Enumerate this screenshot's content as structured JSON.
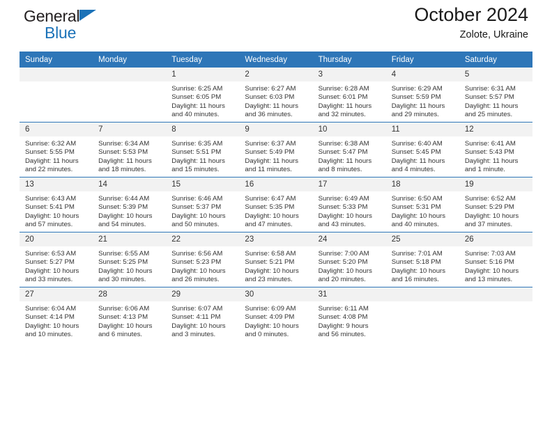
{
  "brand": {
    "line1": "General",
    "line2": "Blue",
    "accent_color": "#1b72b8",
    "triangle_icon": "triangle-icon"
  },
  "header": {
    "title": "October 2024",
    "subtitle": "Zolote, Ukraine"
  },
  "calendar": {
    "header_bg": "#2e76b8",
    "daynum_bg": "#f2f2f2",
    "weekdays": [
      "Sunday",
      "Monday",
      "Tuesday",
      "Wednesday",
      "Thursday",
      "Friday",
      "Saturday"
    ],
    "weeks": [
      [
        {
          "day": "",
          "lines": []
        },
        {
          "day": "",
          "lines": []
        },
        {
          "day": "1",
          "lines": [
            "Sunrise: 6:25 AM",
            "Sunset: 6:05 PM",
            "Daylight: 11 hours",
            "and 40 minutes."
          ]
        },
        {
          "day": "2",
          "lines": [
            "Sunrise: 6:27 AM",
            "Sunset: 6:03 PM",
            "Daylight: 11 hours",
            "and 36 minutes."
          ]
        },
        {
          "day": "3",
          "lines": [
            "Sunrise: 6:28 AM",
            "Sunset: 6:01 PM",
            "Daylight: 11 hours",
            "and 32 minutes."
          ]
        },
        {
          "day": "4",
          "lines": [
            "Sunrise: 6:29 AM",
            "Sunset: 5:59 PM",
            "Daylight: 11 hours",
            "and 29 minutes."
          ]
        },
        {
          "day": "5",
          "lines": [
            "Sunrise: 6:31 AM",
            "Sunset: 5:57 PM",
            "Daylight: 11 hours",
            "and 25 minutes."
          ]
        }
      ],
      [
        {
          "day": "6",
          "lines": [
            "Sunrise: 6:32 AM",
            "Sunset: 5:55 PM",
            "Daylight: 11 hours",
            "and 22 minutes."
          ]
        },
        {
          "day": "7",
          "lines": [
            "Sunrise: 6:34 AM",
            "Sunset: 5:53 PM",
            "Daylight: 11 hours",
            "and 18 minutes."
          ]
        },
        {
          "day": "8",
          "lines": [
            "Sunrise: 6:35 AM",
            "Sunset: 5:51 PM",
            "Daylight: 11 hours",
            "and 15 minutes."
          ]
        },
        {
          "day": "9",
          "lines": [
            "Sunrise: 6:37 AM",
            "Sunset: 5:49 PM",
            "Daylight: 11 hours",
            "and 11 minutes."
          ]
        },
        {
          "day": "10",
          "lines": [
            "Sunrise: 6:38 AM",
            "Sunset: 5:47 PM",
            "Daylight: 11 hours",
            "and 8 minutes."
          ]
        },
        {
          "day": "11",
          "lines": [
            "Sunrise: 6:40 AM",
            "Sunset: 5:45 PM",
            "Daylight: 11 hours",
            "and 4 minutes."
          ]
        },
        {
          "day": "12",
          "lines": [
            "Sunrise: 6:41 AM",
            "Sunset: 5:43 PM",
            "Daylight: 11 hours",
            "and 1 minute."
          ]
        }
      ],
      [
        {
          "day": "13",
          "lines": [
            "Sunrise: 6:43 AM",
            "Sunset: 5:41 PM",
            "Daylight: 10 hours",
            "and 57 minutes."
          ]
        },
        {
          "day": "14",
          "lines": [
            "Sunrise: 6:44 AM",
            "Sunset: 5:39 PM",
            "Daylight: 10 hours",
            "and 54 minutes."
          ]
        },
        {
          "day": "15",
          "lines": [
            "Sunrise: 6:46 AM",
            "Sunset: 5:37 PM",
            "Daylight: 10 hours",
            "and 50 minutes."
          ]
        },
        {
          "day": "16",
          "lines": [
            "Sunrise: 6:47 AM",
            "Sunset: 5:35 PM",
            "Daylight: 10 hours",
            "and 47 minutes."
          ]
        },
        {
          "day": "17",
          "lines": [
            "Sunrise: 6:49 AM",
            "Sunset: 5:33 PM",
            "Daylight: 10 hours",
            "and 43 minutes."
          ]
        },
        {
          "day": "18",
          "lines": [
            "Sunrise: 6:50 AM",
            "Sunset: 5:31 PM",
            "Daylight: 10 hours",
            "and 40 minutes."
          ]
        },
        {
          "day": "19",
          "lines": [
            "Sunrise: 6:52 AM",
            "Sunset: 5:29 PM",
            "Daylight: 10 hours",
            "and 37 minutes."
          ]
        }
      ],
      [
        {
          "day": "20",
          "lines": [
            "Sunrise: 6:53 AM",
            "Sunset: 5:27 PM",
            "Daylight: 10 hours",
            "and 33 minutes."
          ]
        },
        {
          "day": "21",
          "lines": [
            "Sunrise: 6:55 AM",
            "Sunset: 5:25 PM",
            "Daylight: 10 hours",
            "and 30 minutes."
          ]
        },
        {
          "day": "22",
          "lines": [
            "Sunrise: 6:56 AM",
            "Sunset: 5:23 PM",
            "Daylight: 10 hours",
            "and 26 minutes."
          ]
        },
        {
          "day": "23",
          "lines": [
            "Sunrise: 6:58 AM",
            "Sunset: 5:21 PM",
            "Daylight: 10 hours",
            "and 23 minutes."
          ]
        },
        {
          "day": "24",
          "lines": [
            "Sunrise: 7:00 AM",
            "Sunset: 5:20 PM",
            "Daylight: 10 hours",
            "and 20 minutes."
          ]
        },
        {
          "day": "25",
          "lines": [
            "Sunrise: 7:01 AM",
            "Sunset: 5:18 PM",
            "Daylight: 10 hours",
            "and 16 minutes."
          ]
        },
        {
          "day": "26",
          "lines": [
            "Sunrise: 7:03 AM",
            "Sunset: 5:16 PM",
            "Daylight: 10 hours",
            "and 13 minutes."
          ]
        }
      ],
      [
        {
          "day": "27",
          "lines": [
            "Sunrise: 6:04 AM",
            "Sunset: 4:14 PM",
            "Daylight: 10 hours",
            "and 10 minutes."
          ]
        },
        {
          "day": "28",
          "lines": [
            "Sunrise: 6:06 AM",
            "Sunset: 4:13 PM",
            "Daylight: 10 hours",
            "and 6 minutes."
          ]
        },
        {
          "day": "29",
          "lines": [
            "Sunrise: 6:07 AM",
            "Sunset: 4:11 PM",
            "Daylight: 10 hours",
            "and 3 minutes."
          ]
        },
        {
          "day": "30",
          "lines": [
            "Sunrise: 6:09 AM",
            "Sunset: 4:09 PM",
            "Daylight: 10 hours",
            "and 0 minutes."
          ]
        },
        {
          "day": "31",
          "lines": [
            "Sunrise: 6:11 AM",
            "Sunset: 4:08 PM",
            "Daylight: 9 hours",
            "and 56 minutes."
          ]
        },
        {
          "day": "",
          "lines": []
        },
        {
          "day": "",
          "lines": []
        }
      ]
    ]
  }
}
